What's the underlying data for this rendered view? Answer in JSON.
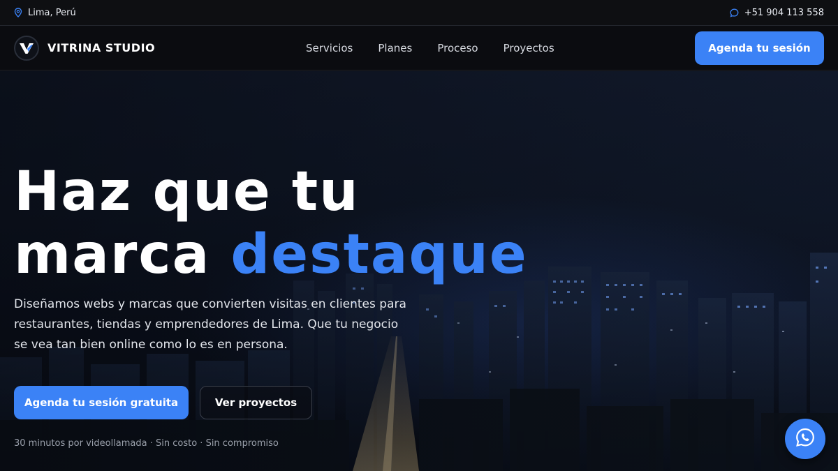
{
  "topbar": {
    "location": "Lima, Perú",
    "phone": "+51 904 113 558",
    "location_icon": "map-pin-icon",
    "phone_icon": "chat-bubble-icon"
  },
  "nav": {
    "brand": "VITRINA STUDIO",
    "logo_icon": "vitrina-logo-icon",
    "items": [
      {
        "label": "Servicios"
      },
      {
        "label": "Planes"
      },
      {
        "label": "Proceso"
      },
      {
        "label": "Proyectos"
      }
    ],
    "cta": "Agenda tu sesión"
  },
  "hero": {
    "headline_line1": "Haz que tu",
    "headline_line2_plain": "marca",
    "headline_line2_accent": "destaque",
    "lead": "Diseñamos webs y marcas que convierten visitas en clientes para restaurantes, tiendas y emprendedores de Lima. Que tu negocio se vea tan bien online como lo es en persona.",
    "primary_cta": "Agenda tu sesión gratuita",
    "secondary_cta": "Ver proyectos",
    "note": "30 minutos por videollamada · Sin costo · Sin compromiso"
  },
  "whatsapp_icon": "whatsapp-icon",
  "colors": {
    "accent": "#3b82f6",
    "background": "#0b0d12"
  }
}
